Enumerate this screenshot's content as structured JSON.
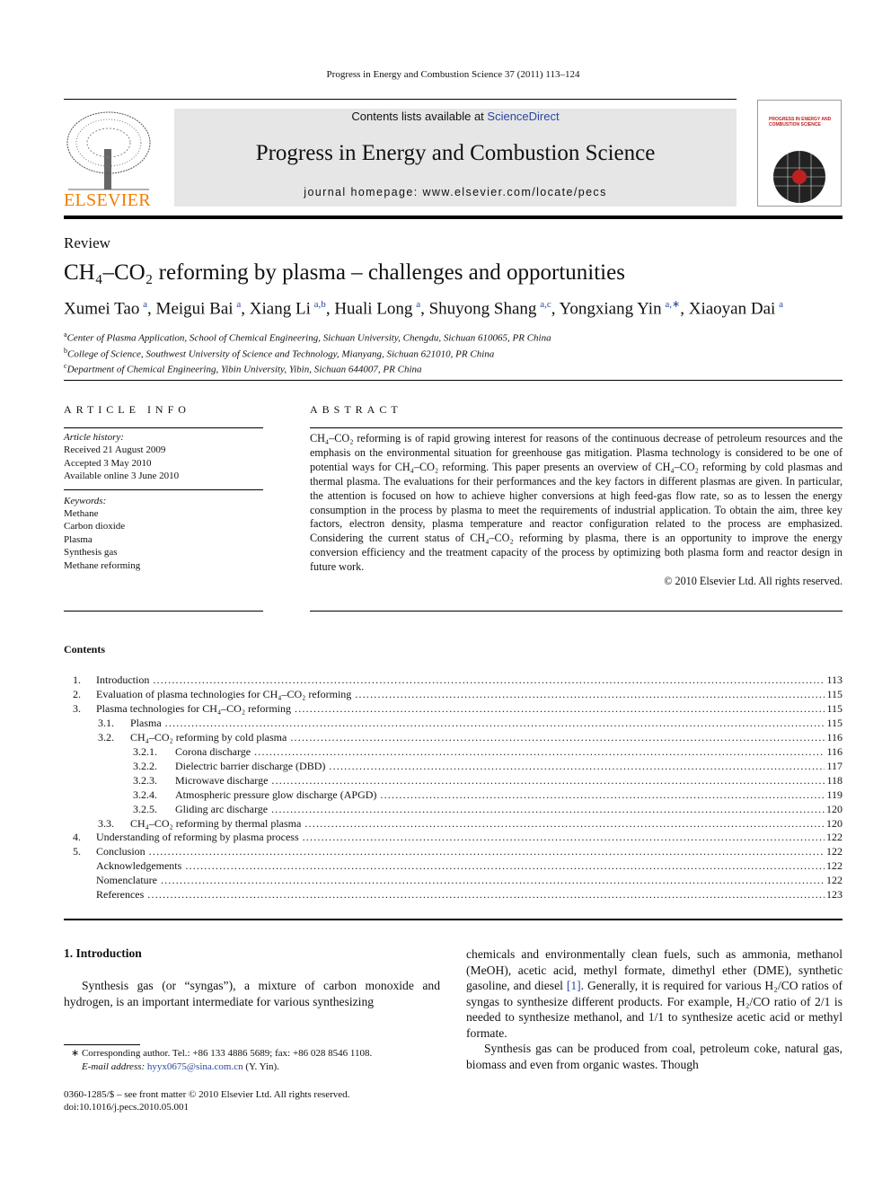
{
  "header": {
    "citation": "Progress in Energy and Combustion Science 37 (2011) 113–124",
    "contents_prefix": "Contents lists available at ",
    "sciencedirect": "ScienceDirect",
    "journal_title": "Progress in Energy and Combustion Science",
    "homepage": "journal homepage: www.elsevier.com/locate/pecs",
    "publisher": "ELSEVIER",
    "cover_title": "PROGRESS IN ENERGY AND COMBUSTION SCIENCE"
  },
  "article": {
    "type": "Review",
    "title": "CH₄–CO₂ reforming by plasma – challenges and opportunities",
    "authors": [
      {
        "name": "Xumei Tao",
        "aff": "a"
      },
      {
        "name": "Meigui Bai",
        "aff": "a"
      },
      {
        "name": "Xiang Li",
        "aff": "a,b"
      },
      {
        "name": "Huali Long",
        "aff": "a"
      },
      {
        "name": "Shuyong Shang",
        "aff": "a,c"
      },
      {
        "name": "Yongxiang Yin",
        "aff": "a,∗"
      },
      {
        "name": "Xiaoyan Dai",
        "aff": "a"
      }
    ],
    "affiliations": [
      {
        "key": "a",
        "text": "Center of Plasma Application, School of Chemical Engineering, Sichuan University, Chengdu, Sichuan 610065, PR China"
      },
      {
        "key": "b",
        "text": "College of Science, Southwest University of Science and Technology, Mianyang, Sichuan 621010, PR China"
      },
      {
        "key": "c",
        "text": "Department of Chemical Engineering, Yibin University, Yibin, Sichuan 644007, PR China"
      }
    ]
  },
  "article_info": {
    "heading": "ARTICLE INFO",
    "history_label": "Article history:",
    "history": [
      "Received 21 August 2009",
      "Accepted 3 May 2010",
      "Available online 3 June 2010"
    ],
    "keywords_label": "Keywords:",
    "keywords": [
      "Methane",
      "Carbon dioxide",
      "Plasma",
      "Synthesis gas",
      "Methane reforming"
    ]
  },
  "abstract": {
    "heading": "ABSTRACT",
    "text": "CH₄–CO₂ reforming is of rapid growing interest for reasons of the continuous decrease of petroleum resources and the emphasis on the environmental situation for greenhouse gas mitigation. Plasma technology is considered to be one of potential ways for CH₄–CO₂ reforming. This paper presents an overview of CH₄–CO₂ reforming by cold plasmas and thermal plasma. The evaluations for their performances and the key factors in different plasmas are given. In particular, the attention is focused on how to achieve higher conversions at high feed-gas flow rate, so as to lessen the energy consumption in the process by plasma to meet the requirements of industrial application. To obtain the aim, three key factors, electron density, plasma temperature and reactor configuration related to the process are emphasized. Considering the current status of CH₄–CO₂ reforming by plasma, there is an opportunity to improve the energy conversion efficiency and the treatment capacity of the process by optimizing both plasma form and reactor design in future work.",
    "copyright": "© 2010 Elsevier Ltd. All rights reserved."
  },
  "contents": {
    "heading": "Contents",
    "items": [
      {
        "num": "1.",
        "label": "Introduction",
        "page": "113",
        "level": 0
      },
      {
        "num": "2.",
        "label": "Evaluation of plasma technologies for CH₄–CO₂ reforming",
        "page": "115",
        "level": 0
      },
      {
        "num": "3.",
        "label": "Plasma technologies for CH₄–CO₂ reforming",
        "page": "115",
        "level": 0
      },
      {
        "num": "3.1.",
        "label": "Plasma",
        "page": "115",
        "level": 1
      },
      {
        "num": "3.2.",
        "label": "CH₄–CO₂ reforming by cold plasma",
        "page": "116",
        "level": 1
      },
      {
        "num": "3.2.1.",
        "label": "Corona discharge",
        "page": "116",
        "level": 2
      },
      {
        "num": "3.2.2.",
        "label": "Dielectric barrier discharge (DBD)",
        "page": "117",
        "level": 2
      },
      {
        "num": "3.2.3.",
        "label": "Microwave discharge",
        "page": "118",
        "level": 2
      },
      {
        "num": "3.2.4.",
        "label": "Atmospheric pressure glow discharge (APGD)",
        "page": "119",
        "level": 2
      },
      {
        "num": "3.2.5.",
        "label": "Gliding arc discharge",
        "page": "120",
        "level": 2
      },
      {
        "num": "3.3.",
        "label": "CH₄–CO₂ reforming by thermal plasma",
        "page": "120",
        "level": 1
      },
      {
        "num": "4.",
        "label": "Understanding of reforming by plasma process",
        "page": "122",
        "level": 0
      },
      {
        "num": "5.",
        "label": "Conclusion",
        "page": "122",
        "level": 0
      },
      {
        "num": "",
        "label": "Acknowledgements",
        "page": "122",
        "level": 0
      },
      {
        "num": "",
        "label": "Nomenclature",
        "page": "122",
        "level": 0
      },
      {
        "num": "",
        "label": "References",
        "page": "123",
        "level": 0
      }
    ]
  },
  "intro": {
    "heading": "1.  Introduction",
    "left_para": "Synthesis gas (or “syngas”), a mixture of carbon monoxide and hydrogen, is an important intermediate for various synthesizing",
    "right_para1_a": "chemicals and environmentally clean fuels, such as ammonia, methanol (MeOH), acetic acid, methyl formate, dimethyl ether (DME), synthetic gasoline, and diesel ",
    "ref": "[1]",
    "right_para1_b": ". Generally, it is required for various H₂/CO ratios of syngas to synthesize different products. For example, H₂/CO ratio of 2/1 is needed to synthesize methanol, and 1/1 to synthesize acetic acid or methyl formate.",
    "right_para2": "Synthesis gas can be produced from coal, petroleum coke, natural gas, biomass and even from organic wastes. Though"
  },
  "footnote": {
    "corresponding": "∗  Corresponding author. Tel.: +86 133 4886 5689; fax: +86 028 8546 1108.",
    "email_label": "E-mail address: ",
    "email": "hyyx0675@sina.com.cn",
    "email_suffix": " (Y. Yin)."
  },
  "bottom": {
    "issn": "0360-1285/$ – see front matter © 2010 Elsevier Ltd. All rights reserved.",
    "doi": "doi:10.1016/j.pecs.2010.05.001"
  },
  "colors": {
    "link": "#2a47a0",
    "banner": "#e6e6e6",
    "elsevier": "#f07d00"
  }
}
